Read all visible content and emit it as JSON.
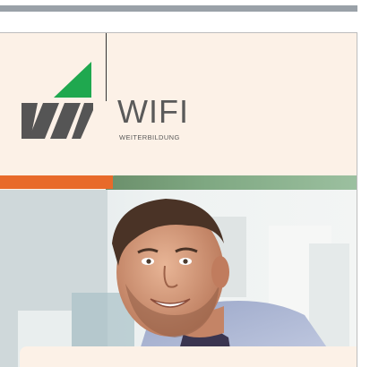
{
  "brand": {
    "name": "WIFI",
    "tagline": "WEITERBILDUNG",
    "colors": {
      "green": "#1fa84f",
      "gray": "#555555",
      "orange": "#e86a2a",
      "cream": "#fcf1e7"
    }
  },
  "hero": {
    "image": "portrait-smiling-man"
  }
}
